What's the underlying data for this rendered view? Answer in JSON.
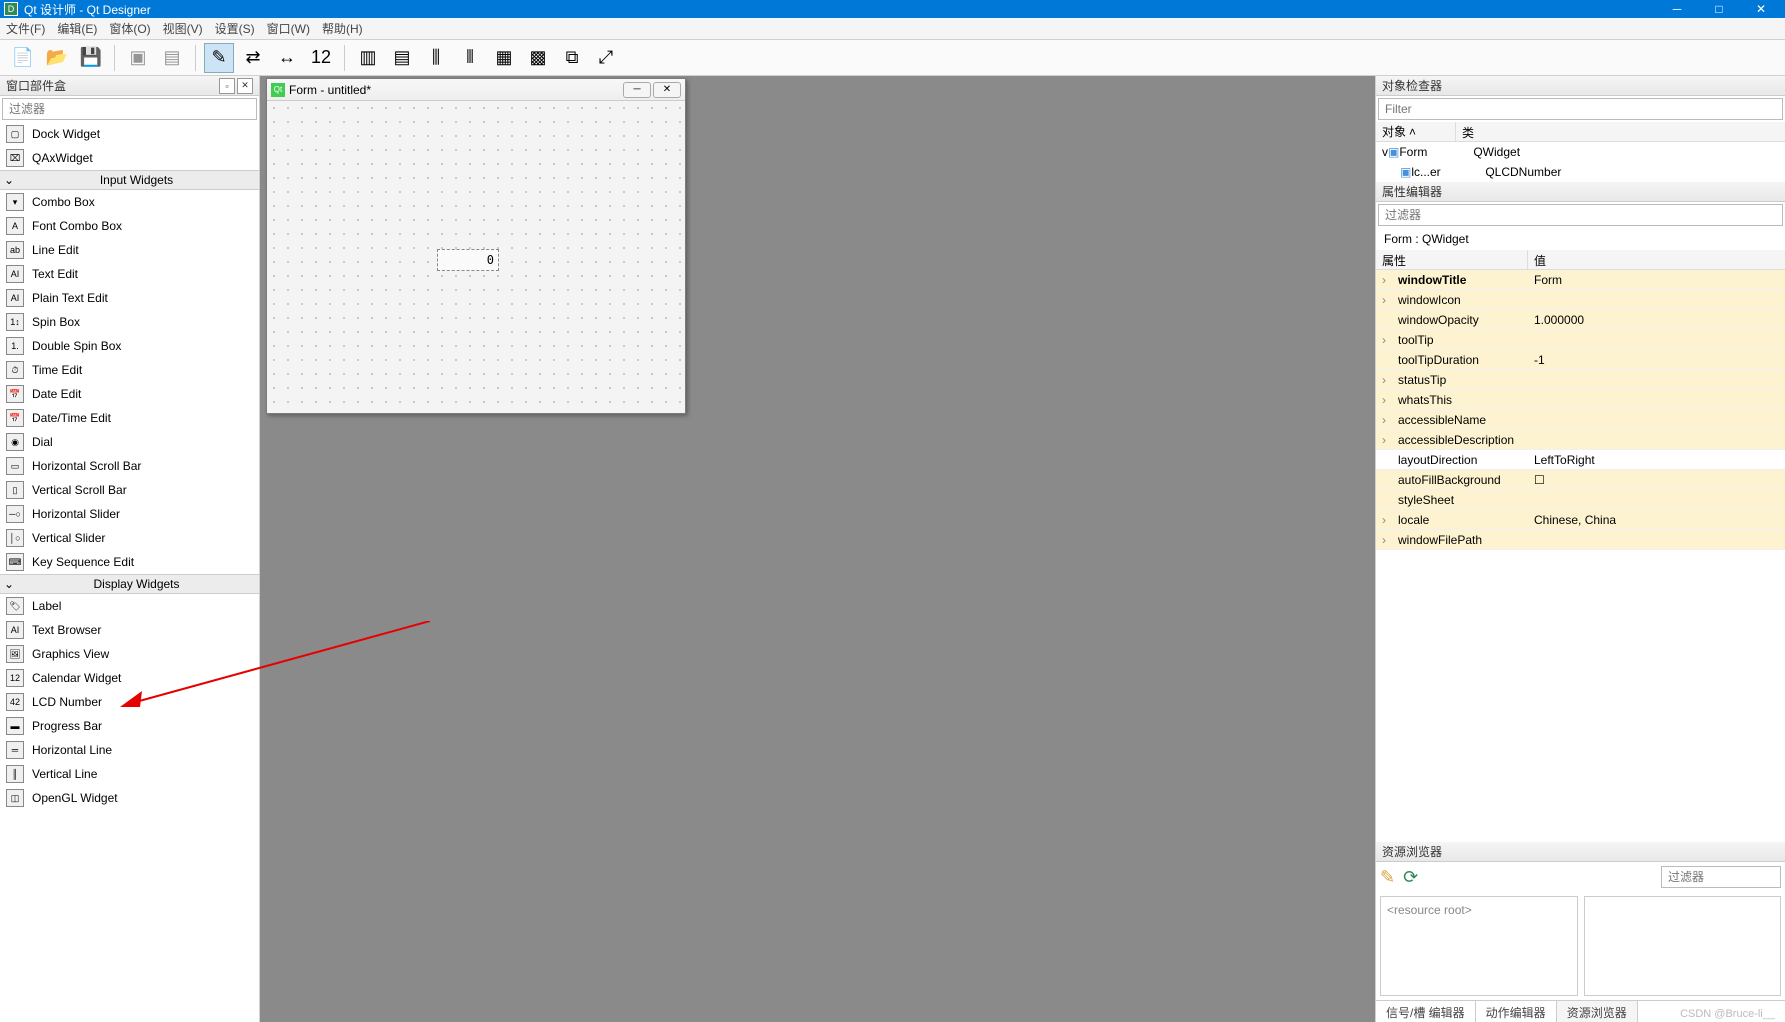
{
  "title": "Qt 设计师 - Qt Designer",
  "menus": [
    "文件(F)",
    "编辑(E)",
    "窗体(O)",
    "视图(V)",
    "设置(S)",
    "窗口(W)",
    "帮助(H)"
  ],
  "widgetbox": {
    "title": "窗口部件盒",
    "filter_placeholder": "过滤器",
    "pre_items": [
      {
        "ico": "▢",
        "label": "Dock Widget"
      },
      {
        "ico": "⌧",
        "label": "QAxWidget"
      }
    ],
    "cat_input": "Input Widgets",
    "input_items": [
      {
        "ico": "▾",
        "label": "Combo Box"
      },
      {
        "ico": "A",
        "label": "Font Combo Box"
      },
      {
        "ico": "ab",
        "label": "Line Edit"
      },
      {
        "ico": "AI",
        "label": "Text Edit"
      },
      {
        "ico": "AI",
        "label": "Plain Text Edit"
      },
      {
        "ico": "1↕",
        "label": "Spin Box"
      },
      {
        "ico": "1.",
        "label": "Double Spin Box"
      },
      {
        "ico": "⏱",
        "label": "Time Edit"
      },
      {
        "ico": "📅",
        "label": "Date Edit"
      },
      {
        "ico": "📅",
        "label": "Date/Time Edit"
      },
      {
        "ico": "◉",
        "label": "Dial"
      },
      {
        "ico": "▭",
        "label": "Horizontal Scroll Bar"
      },
      {
        "ico": "▯",
        "label": "Vertical Scroll Bar"
      },
      {
        "ico": "─○",
        "label": "Horizontal Slider"
      },
      {
        "ico": "│○",
        "label": "Vertical Slider"
      },
      {
        "ico": "⌨",
        "label": "Key Sequence Edit"
      }
    ],
    "cat_display": "Display Widgets",
    "display_items": [
      {
        "ico": "🏷",
        "label": "Label"
      },
      {
        "ico": "AI",
        "label": "Text Browser"
      },
      {
        "ico": "🖼",
        "label": "Graphics View"
      },
      {
        "ico": "12",
        "label": "Calendar Widget"
      },
      {
        "ico": "42",
        "label": "LCD Number"
      },
      {
        "ico": "▬",
        "label": "Progress Bar"
      },
      {
        "ico": "═",
        "label": "Horizontal Line"
      },
      {
        "ico": "║",
        "label": "Vertical Line"
      },
      {
        "ico": "◫",
        "label": "OpenGL Widget"
      }
    ]
  },
  "form": {
    "title": "Form - untitled*",
    "lcd_value": "0"
  },
  "object_inspector": {
    "title": "对象检查器",
    "filter_placeholder": "Filter",
    "cols": [
      "对象",
      "类"
    ],
    "rows": [
      {
        "obj": "Form",
        "cls": "QWidget",
        "indent": 0,
        "expand": "v"
      },
      {
        "obj": "lc...er",
        "cls": "QLCDNumber",
        "indent": 1,
        "expand": ""
      }
    ]
  },
  "property_editor": {
    "title": "属性编辑器",
    "filter_placeholder": "过滤器",
    "target": "Form : QWidget",
    "cols": [
      "属性",
      "值"
    ],
    "rows": [
      {
        "n": "windowTitle",
        "v": "Form",
        "exp": "›",
        "y": true,
        "bold": true
      },
      {
        "n": "windowIcon",
        "v": "",
        "exp": "›",
        "y": true
      },
      {
        "n": "windowOpacity",
        "v": "1.000000",
        "exp": "",
        "y": true
      },
      {
        "n": "toolTip",
        "v": "",
        "exp": "›",
        "y": true
      },
      {
        "n": "toolTipDuration",
        "v": "-1",
        "exp": "",
        "y": true
      },
      {
        "n": "statusTip",
        "v": "",
        "exp": "›",
        "y": true
      },
      {
        "n": "whatsThis",
        "v": "",
        "exp": "›",
        "y": true
      },
      {
        "n": "accessibleName",
        "v": "",
        "exp": "›",
        "y": true
      },
      {
        "n": "accessibleDescription",
        "v": "",
        "exp": "›",
        "y": true
      },
      {
        "n": "layoutDirection",
        "v": "LeftToRight",
        "exp": "",
        "y": false
      },
      {
        "n": "autoFillBackground",
        "v": "☐",
        "exp": "",
        "y": true
      },
      {
        "n": "styleSheet",
        "v": "",
        "exp": "",
        "y": true
      },
      {
        "n": "locale",
        "v": "Chinese, China",
        "exp": "›",
        "y": true
      },
      {
        "n": "windowFilePath",
        "v": "",
        "exp": "›",
        "y": true
      }
    ]
  },
  "resource_browser": {
    "title": "资源浏览器",
    "filter_placeholder": "过滤器",
    "root": "<resource root>",
    "tabs": [
      "信号/槽 编辑器",
      "动作编辑器",
      "资源浏览器"
    ]
  },
  "watermark": "CSDN @Bruce-li__"
}
